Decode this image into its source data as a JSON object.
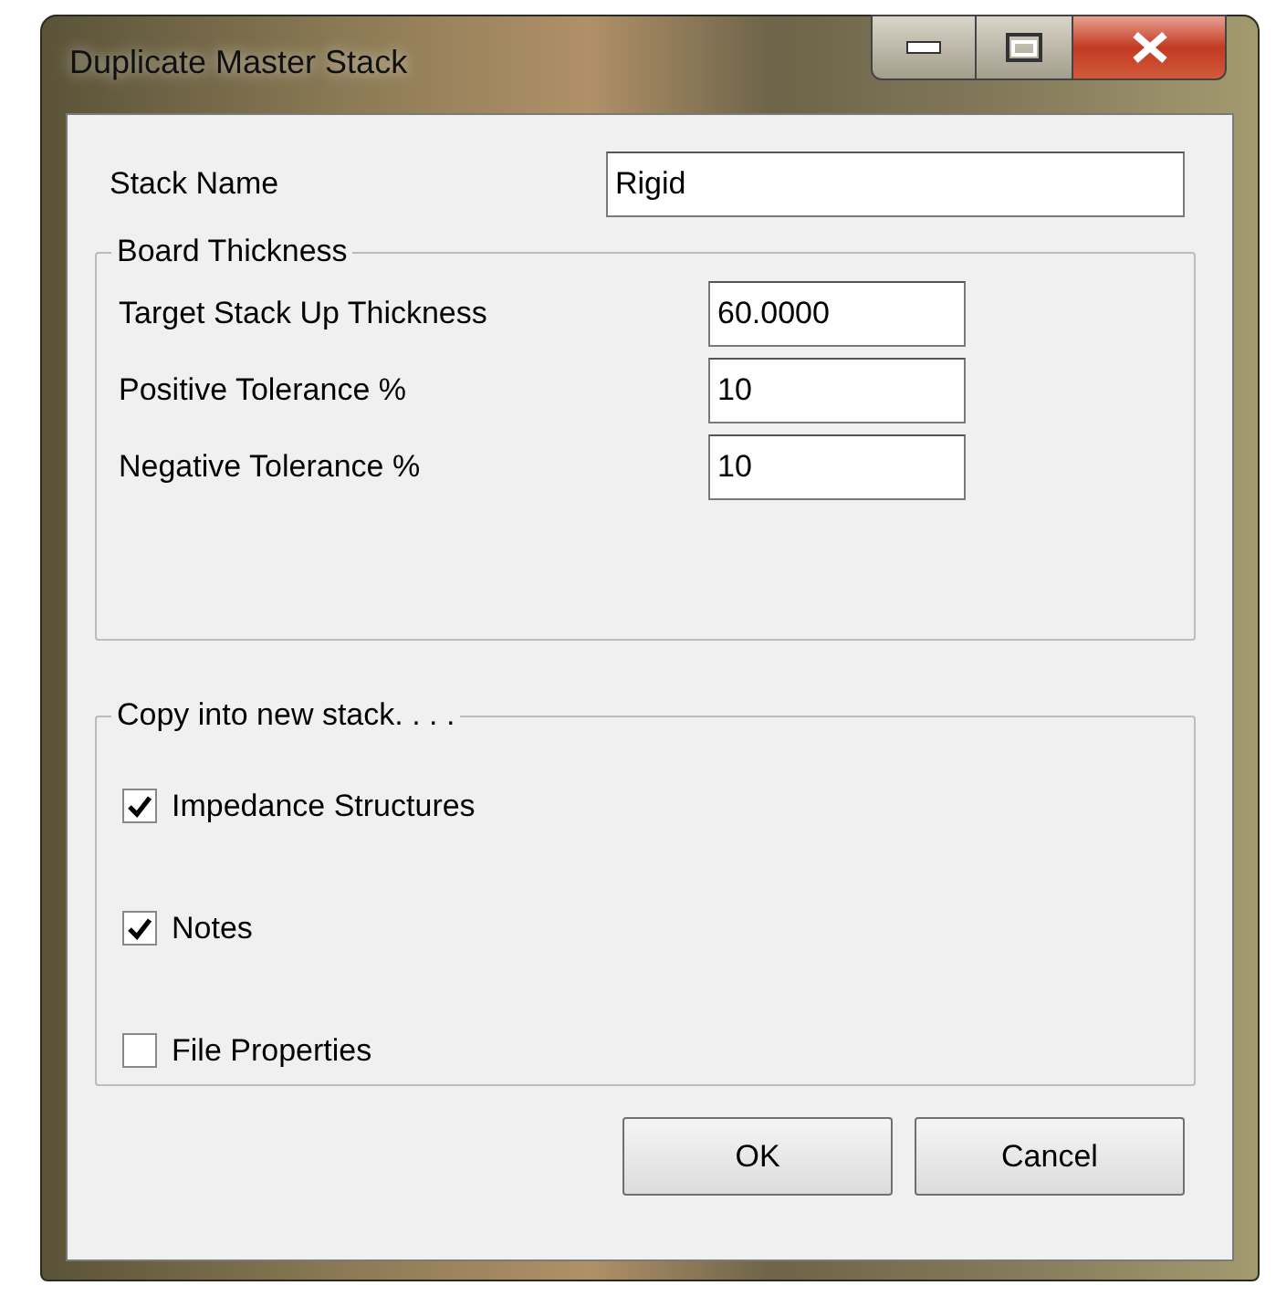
{
  "window": {
    "title": "Duplicate Master Stack"
  },
  "stack_name": {
    "label": "Stack Name",
    "value": "Rigid"
  },
  "board_thickness": {
    "title": "Board Thickness",
    "fields": [
      {
        "label": "Target Stack Up Thickness",
        "value": "60.0000"
      },
      {
        "label": "Positive Tolerance %",
        "value": "10"
      },
      {
        "label": "Negative Tolerance %",
        "value": "10"
      }
    ]
  },
  "copy_options": {
    "title": "Copy into new stack. . . .",
    "items": [
      {
        "label": "Impedance Structures",
        "checked": true
      },
      {
        "label": "Notes",
        "checked": true
      },
      {
        "label": "File Properties",
        "checked": false
      }
    ]
  },
  "buttons": [
    "OK",
    "Cancel"
  ]
}
